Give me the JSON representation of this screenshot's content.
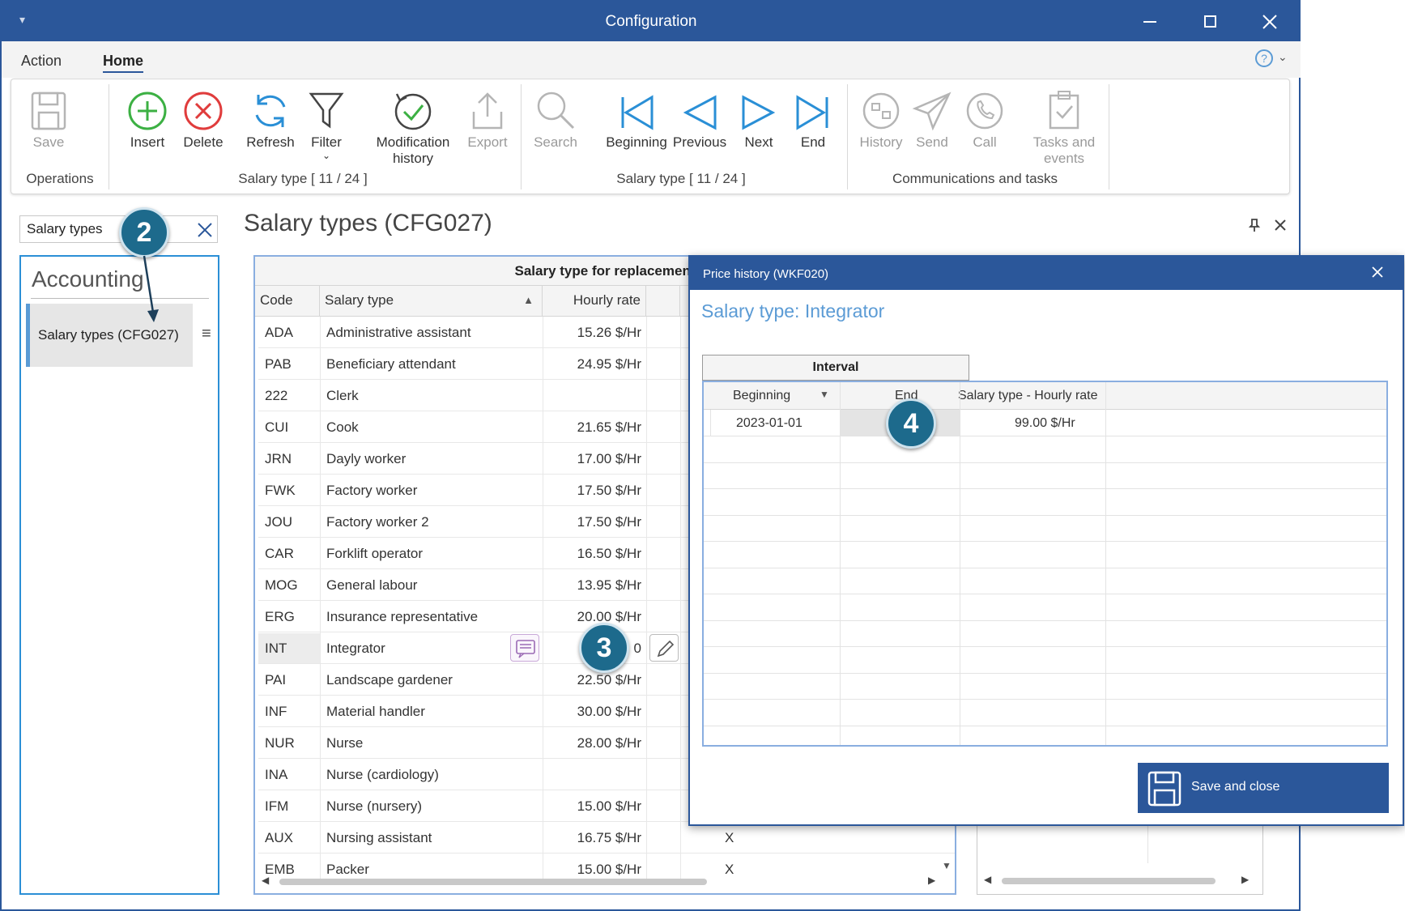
{
  "window": {
    "title": "Configuration"
  },
  "menu": {
    "action": "Action",
    "home": "Home"
  },
  "ribbon": {
    "save": "Save",
    "insert": "Insert",
    "delete": "Delete",
    "refresh": "Refresh",
    "filter": "Filter",
    "modification_history": [
      "Modification",
      "history"
    ],
    "export": "Export",
    "search": "Search",
    "beginning": "Beginning",
    "previous": "Previous",
    "next": "Next",
    "end": "End",
    "history": "History",
    "send": "Send",
    "call": "Call",
    "tasks_events": [
      "Tasks and",
      "events"
    ],
    "group_operations": "Operations",
    "group_salary1": "Salary type [ 11 / 24 ]",
    "group_salary2": "Salary type [ 11 / 24 ]",
    "group_comm": "Communications and tasks"
  },
  "nav": {
    "search_value": "Salary types",
    "section": "Accounting",
    "item": "Salary types (CFG027)"
  },
  "panel": {
    "title": "Salary types (CFG027)"
  },
  "grid": {
    "band_header": "Salary type for replacement",
    "columns": [
      "Code",
      "Salary type",
      "Hourly rate"
    ],
    "rows": [
      {
        "code": "ADA",
        "type": "Administrative assistant",
        "rate": "15.26 $/Hr",
        "x": ""
      },
      {
        "code": "PAB",
        "type": "Beneficiary attendant",
        "rate": "24.95 $/Hr",
        "x": ""
      },
      {
        "code": "222",
        "type": "Clerk",
        "rate": "",
        "x": ""
      },
      {
        "code": "CUI",
        "type": "Cook",
        "rate": "21.65 $/Hr",
        "x": ""
      },
      {
        "code": "JRN",
        "type": "Dayly worker",
        "rate": "17.00 $/Hr",
        "x": ""
      },
      {
        "code": "FWK",
        "type": "Factory worker",
        "rate": "17.50 $/Hr",
        "x": ""
      },
      {
        "code": "JOU",
        "type": "Factory worker 2",
        "rate": "17.50 $/Hr",
        "x": ""
      },
      {
        "code": "CAR",
        "type": "Forklift operator",
        "rate": "16.50 $/Hr",
        "x": ""
      },
      {
        "code": "MOG",
        "type": "General labour",
        "rate": "13.95 $/Hr",
        "x": ""
      },
      {
        "code": "ERG",
        "type": "Insurance representative",
        "rate": "20.00 $/Hr",
        "x": ""
      },
      {
        "code": "INT",
        "type": "Integrator",
        "rate": "0",
        "x": ""
      },
      {
        "code": "PAI",
        "type": "Landscape gardener",
        "rate": "22.50 $/Hr",
        "x": ""
      },
      {
        "code": "INF",
        "type": "Material handler",
        "rate": "30.00 $/Hr",
        "x": ""
      },
      {
        "code": "NUR",
        "type": "Nurse",
        "rate": "28.00 $/Hr",
        "x": ""
      },
      {
        "code": "INA",
        "type": "Nurse (cardiology)",
        "rate": "",
        "x": ""
      },
      {
        "code": "IFM",
        "type": "Nurse (nursery)",
        "rate": "15.00 $/Hr",
        "x": ""
      },
      {
        "code": "AUX",
        "type": "Nursing assistant",
        "rate": "16.75 $/Hr",
        "x": "X"
      },
      {
        "code": "EMB",
        "type": "Packer",
        "rate": "15.00 $/Hr",
        "x": "X"
      }
    ]
  },
  "dialog": {
    "title": "Price history (WKF020)",
    "heading": "Salary type: Integrator",
    "band": "Interval",
    "columns": [
      "Beginning",
      "End",
      "Salary type - Hourly rate"
    ],
    "row": {
      "beginning": "2023-01-01",
      "end": "",
      "rate": "99.00 $/Hr"
    },
    "save_close": "Save and close"
  },
  "callouts": {
    "c2": "2",
    "c3": "3",
    "c4": "4"
  }
}
